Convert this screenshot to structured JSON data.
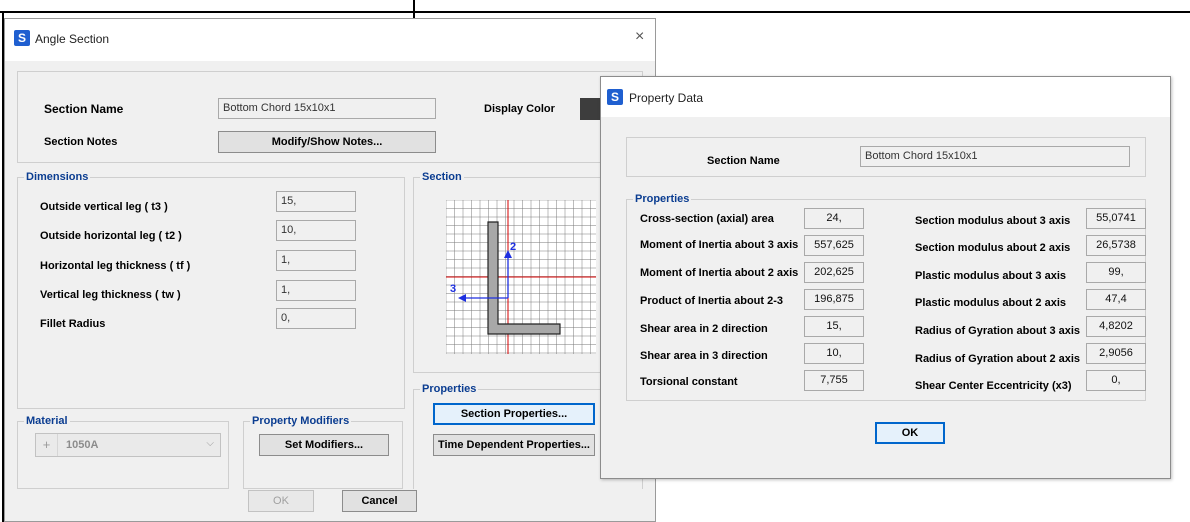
{
  "angle_window": {
    "title": "Angle Section",
    "section_name_label": "Section Name",
    "section_name_value": "Bottom Chord 15x10x1",
    "display_color_label": "Display Color",
    "section_notes_label": "Section Notes",
    "modify_notes_button": "Modify/Show Notes...",
    "dimensions": {
      "title": "Dimensions",
      "rows": [
        {
          "label": "Outside vertical leg  ( t3 )",
          "value": "15,"
        },
        {
          "label": "Outside horizontal leg  ( t2 )",
          "value": "10,"
        },
        {
          "label": "Horizontal leg thickness  ( tf )",
          "value": "1,"
        },
        {
          "label": "Vertical leg thickness  ( tw )",
          "value": "1,"
        },
        {
          "label": "Fillet Radius",
          "value": "0,"
        }
      ]
    },
    "section_group_title": "Section",
    "section_axis_2": "2",
    "section_axis_3": "3",
    "properties_group_title": "Properties",
    "section_properties_button": "Section Properties...",
    "time_dependent_button": "Time Dependent Properties...",
    "material": {
      "title": "Material",
      "value": "1050A",
      "plus": "+"
    },
    "property_modifiers": {
      "title": "Property Modifiers",
      "button": "Set Modifiers..."
    },
    "ok_button": "OK",
    "cancel_button": "Cancel"
  },
  "property_window": {
    "title": "Property Data",
    "section_name_label": "Section Name",
    "section_name_value": "Bottom Chord 15x10x1",
    "properties_title": "Properties",
    "left_rows": [
      {
        "label": "Cross-section (axial) area",
        "value": "24,"
      },
      {
        "label": "Moment of Inertia about 3 axis",
        "value": "557,625"
      },
      {
        "label": "Moment of Inertia about 2 axis",
        "value": "202,625"
      },
      {
        "label": "Product of Inertia about 2-3",
        "value": "196,875"
      },
      {
        "label": "Shear area in 2 direction",
        "value": "15,"
      },
      {
        "label": "Shear area in 3 direction",
        "value": "10,"
      },
      {
        "label": "Torsional constant",
        "value": "7,755"
      }
    ],
    "right_rows": [
      {
        "label": "Section modulus about 3 axis",
        "value": "55,0741"
      },
      {
        "label": "Section modulus about 2 axis",
        "value": "26,5738"
      },
      {
        "label": "Plastic modulus about 3 axis",
        "value": "99,"
      },
      {
        "label": "Plastic modulus about 2 axis",
        "value": "47,4"
      },
      {
        "label": "Radius of Gyration about 3 axis",
        "value": "4,8202"
      },
      {
        "label": "Radius of Gyration about 2 axis",
        "value": "2,9056"
      },
      {
        "label": "Shear Center Eccentricity (x3)",
        "value": "0,"
      }
    ],
    "ok_button": "OK"
  },
  "logo_letter": "S",
  "close_glyph": "×",
  "chevron_glyph": "⌵",
  "colors": {
    "accent": "#0066cc",
    "group_title": "#0b3d91",
    "logo": "#1f5fd0",
    "section_shape": "#a8a8a8",
    "axis_blue": "#1d2fe0",
    "grid_red": "#d40000"
  }
}
